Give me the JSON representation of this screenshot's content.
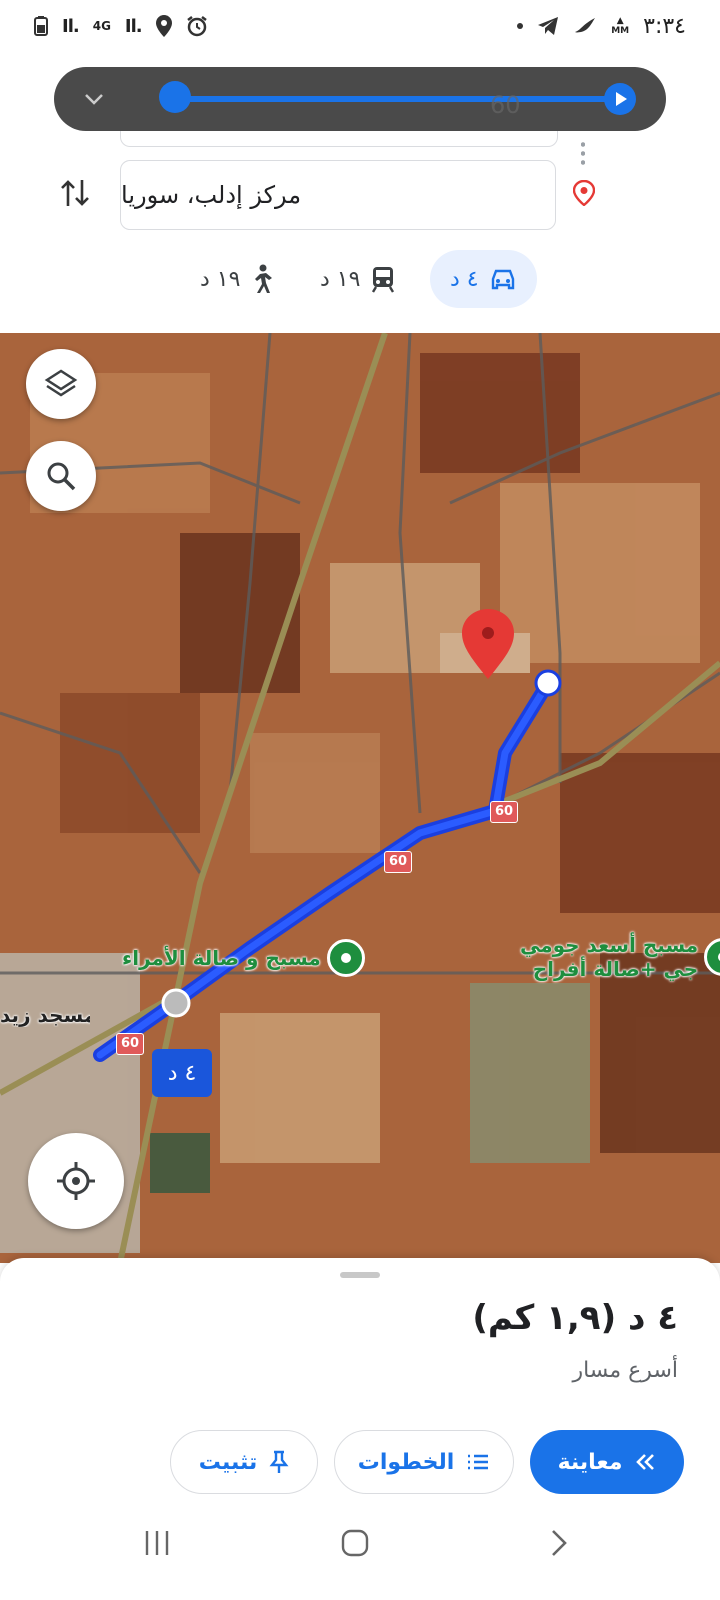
{
  "status_bar": {
    "time": "٣:٣٤",
    "network": "4G",
    "signal": "Il.",
    "indicators": [
      "battery-icon",
      "signal-icon",
      "location-icon",
      "alarm-icon",
      "telegram-icon",
      "bird-icon",
      "mm-icon"
    ],
    "mm_label": "MM"
  },
  "navigation_preview": {
    "speed_label": "60",
    "slider_fraction": 0.05
  },
  "directions": {
    "destination": "مركز إدلب، سوريا",
    "modes": [
      {
        "name": "driving",
        "label": "٤ د",
        "selected": true
      },
      {
        "name": "transit",
        "label": "١٩ د",
        "selected": false
      },
      {
        "name": "walking",
        "label": "١٩ د",
        "selected": false
      }
    ]
  },
  "map": {
    "eta_badge": "٤ د",
    "road_shields": [
      "60",
      "60",
      "60"
    ],
    "places": [
      {
        "name": "مسبح و صالة الأمراء"
      },
      {
        "name": "مسبح أسعد جومي",
        "line2": "جي +صالة أفراح"
      },
      {
        "name": "مسجد زيد"
      }
    ]
  },
  "route_sheet": {
    "title": "٤ د (١,٩ كم)",
    "subtitle": "أسرع مسار",
    "buttons": {
      "preview": "معاينة",
      "steps": "الخطوات",
      "pin": "تثبيت"
    }
  },
  "colors": {
    "accent": "#1a73e8",
    "route": "#1a3fe0",
    "poi": "#1e8e3e",
    "pin": "#e53935"
  }
}
